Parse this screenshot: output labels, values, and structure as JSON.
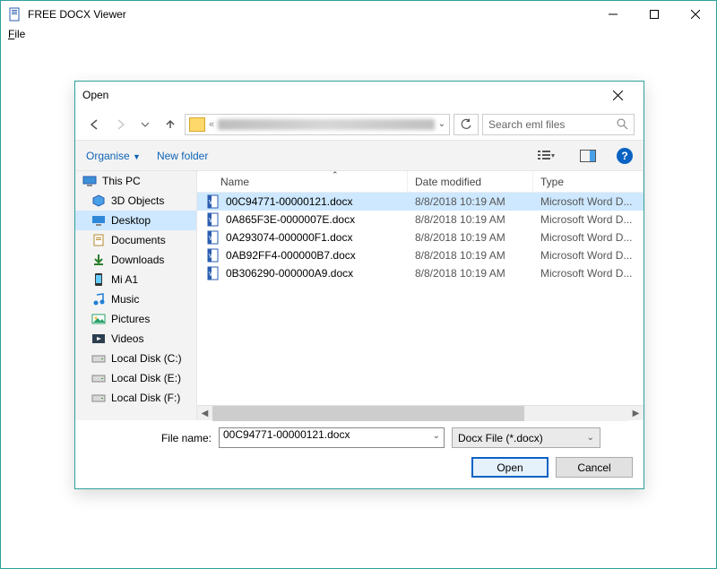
{
  "app": {
    "title": "FREE DOCX Viewer",
    "menu": {
      "file": "File"
    }
  },
  "dialog": {
    "title": "Open",
    "search_placeholder": "Search eml files",
    "toolbar": {
      "organise": "Organise",
      "new_folder": "New folder"
    },
    "columns": {
      "name": "Name",
      "date": "Date modified",
      "type": "Type"
    },
    "sidebar": {
      "root": "This PC",
      "items": [
        {
          "label": "3D Objects"
        },
        {
          "label": "Desktop"
        },
        {
          "label": "Documents"
        },
        {
          "label": "Downloads"
        },
        {
          "label": "Mi A1"
        },
        {
          "label": "Music"
        },
        {
          "label": "Pictures"
        },
        {
          "label": "Videos"
        },
        {
          "label": "Local Disk (C:)"
        },
        {
          "label": "Local Disk (E:)"
        },
        {
          "label": "Local Disk (F:)"
        }
      ],
      "selected_index": 1
    },
    "files": [
      {
        "name": "00C94771-00000121.docx",
        "date": "8/8/2018 10:19 AM",
        "type": "Microsoft Word D..."
      },
      {
        "name": "0A865F3E-0000007E.docx",
        "date": "8/8/2018 10:19 AM",
        "type": "Microsoft Word D..."
      },
      {
        "name": "0A293074-000000F1.docx",
        "date": "8/8/2018 10:19 AM",
        "type": "Microsoft Word D..."
      },
      {
        "name": "0AB92FF4-000000B7.docx",
        "date": "8/8/2018 10:19 AM",
        "type": "Microsoft Word D..."
      },
      {
        "name": "0B306290-000000A9.docx",
        "date": "8/8/2018 10:19 AM",
        "type": "Microsoft Word D..."
      }
    ],
    "selected_file_index": 0,
    "footer": {
      "file_name_label": "File name:",
      "file_name_value": "00C94771-00000121.docx",
      "filter": "Docx File (*.docx)",
      "open": "Open",
      "cancel": "Cancel"
    }
  }
}
